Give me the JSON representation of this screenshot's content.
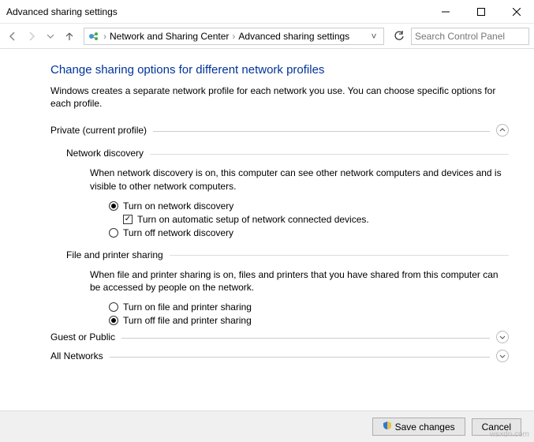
{
  "window": {
    "title": "Advanced sharing settings"
  },
  "breadcrumb": {
    "item1": "Network and Sharing Center",
    "item2": "Advanced sharing settings"
  },
  "search": {
    "placeholder": "Search Control Panel"
  },
  "page": {
    "heading": "Change sharing options for different network profiles",
    "intro": "Windows creates a separate network profile for each network you use. You can choose specific options for each profile."
  },
  "sections": {
    "private": {
      "label": "Private (current profile)",
      "network_discovery": {
        "title": "Network discovery",
        "desc": "When network discovery is on, this computer can see other network computers and devices and is visible to other network computers.",
        "opt_on": "Turn on network discovery",
        "auto_setup": "Turn on automatic setup of network connected devices.",
        "opt_off": "Turn off network discovery"
      },
      "file_printer": {
        "title": "File and printer sharing",
        "desc": "When file and printer sharing is on, files and printers that you have shared from this computer can be accessed by people on the network.",
        "opt_on": "Turn on file and printer sharing",
        "opt_off": "Turn off file and printer sharing"
      }
    },
    "guest": {
      "label": "Guest or Public"
    },
    "all": {
      "label": "All Networks"
    }
  },
  "footer": {
    "save": "Save changes",
    "cancel": "Cancel"
  },
  "watermark": "wsxdn.com"
}
